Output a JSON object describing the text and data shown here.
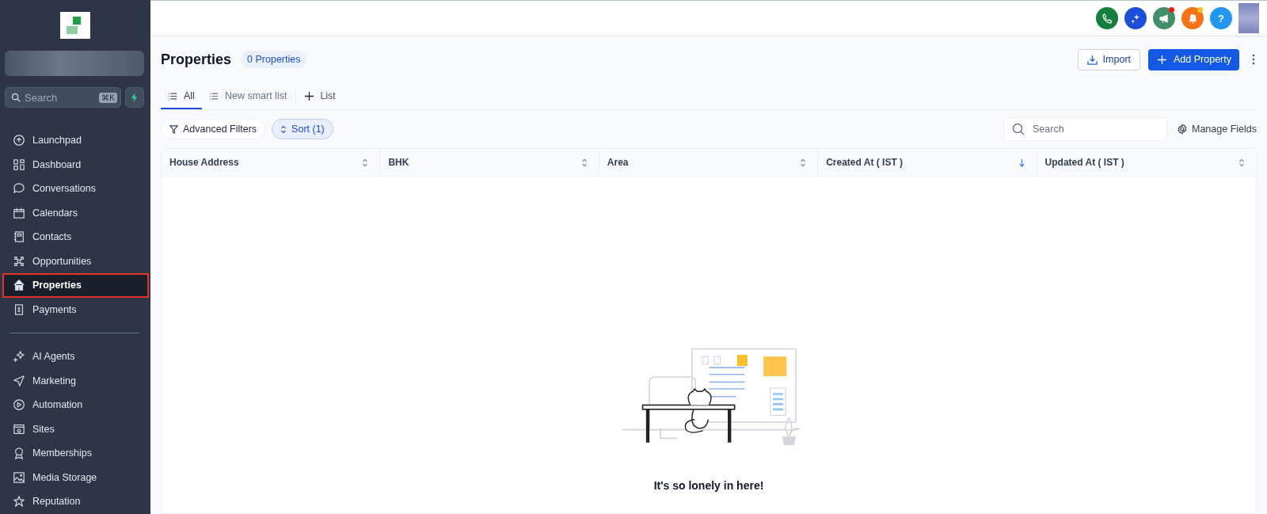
{
  "sidebar": {
    "search": {
      "placeholder": "Search",
      "shortcut": "⌘K"
    },
    "items": [
      {
        "label": "Launchpad",
        "selected": false
      },
      {
        "label": "Dashboard",
        "selected": false
      },
      {
        "label": "Conversations",
        "selected": false
      },
      {
        "label": "Calendars",
        "selected": false
      },
      {
        "label": "Contacts",
        "selected": false
      },
      {
        "label": "Opportunities",
        "selected": false
      },
      {
        "label": "Properties",
        "selected": true
      },
      {
        "label": "Payments",
        "selected": false
      }
    ],
    "secondary_items": [
      {
        "label": "AI Agents",
        "selected": false
      },
      {
        "label": "Marketing",
        "selected": false
      },
      {
        "label": "Automation",
        "selected": false
      },
      {
        "label": "Sites",
        "selected": false
      },
      {
        "label": "Memberships",
        "selected": false
      },
      {
        "label": "Media Storage",
        "selected": false
      },
      {
        "label": "Reputation",
        "selected": false
      }
    ]
  },
  "topbar": {
    "buttons": [
      {
        "kind": "phone",
        "color": "#15803d",
        "badge": false
      },
      {
        "kind": "sparkle",
        "color": "#1d4ed8",
        "badge": false
      },
      {
        "kind": "megaphone",
        "color": "#3f8f6b",
        "badge": true
      },
      {
        "kind": "bell",
        "color": "#f97316",
        "badge": true
      },
      {
        "kind": "help",
        "color": "#2196f3",
        "badge": false,
        "text": "?"
      }
    ]
  },
  "header": {
    "title": "Properties",
    "count": "0 Properties",
    "import": "Import",
    "add": "Add Property"
  },
  "tabs": [
    {
      "label": "All",
      "selected": true
    },
    {
      "label": "New smart list",
      "selected": false
    }
  ],
  "add_list": "List",
  "filters": {
    "advanced": "Advanced Filters",
    "sort": "Sort (1)",
    "search_placeholder": "Search",
    "manage": "Manage Fields"
  },
  "table": {
    "columns": [
      {
        "label": "House Address",
        "sorted": false
      },
      {
        "label": "BHK",
        "sorted": false
      },
      {
        "label": "Area",
        "sorted": false
      },
      {
        "label": "Created At ( IST )",
        "sorted": true
      },
      {
        "label": "Updated At ( IST )",
        "sorted": false
      }
    ]
  },
  "empty_state": {
    "title": "It's so lonely in here!"
  }
}
